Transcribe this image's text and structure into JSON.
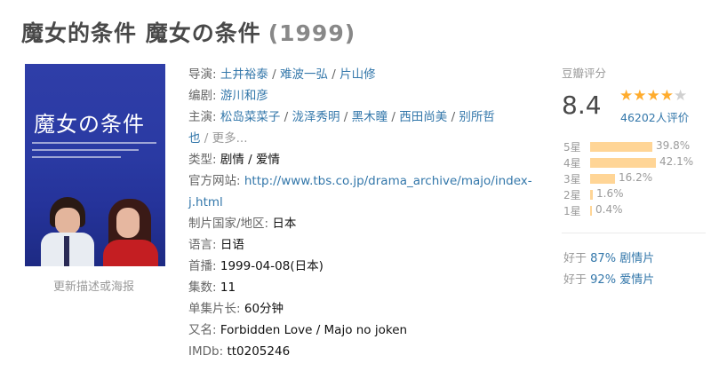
{
  "title": {
    "main": "魔女的条件 魔女の条件",
    "year": "(1999)"
  },
  "poster": {
    "title_text": "魔女の条件"
  },
  "update_link": "更新描述或海报",
  "info": {
    "director_label": "导演:",
    "directors": [
      "土井裕泰",
      "难波一弘",
      "片山修"
    ],
    "writer_label": "编剧:",
    "writers": [
      "游川和彦"
    ],
    "cast_label": "主演:",
    "cast_line1": [
      "松岛菜菜子",
      "泷泽秀明",
      "黑木瞳",
      "西田尚美",
      "别所哲"
    ],
    "cast_line2_start": "也",
    "cast_more": "/ 更多...",
    "genre_label": "类型:",
    "genres": "剧情 / 爱情",
    "site_label": "官方网站:",
    "site_line1": "http://www.tbs.co.jp/drama_archive/majo/index-",
    "site_line2": "j.html",
    "country_label": "制片国家/地区:",
    "country": "日本",
    "language_label": "语言:",
    "language": "日语",
    "premiere_label": "首播:",
    "premiere": "1999-04-08(日本)",
    "episodes_label": "集数:",
    "episodes": "11",
    "runtime_label": "单集片长:",
    "runtime": "60分钟",
    "aka_label": "又名:",
    "aka": "Forbidden Love / Majo no joken",
    "imdb_label": "IMDb:",
    "imdb": "tt0205246"
  },
  "rating": {
    "label": "豆瓣评分",
    "score": "8.4",
    "stars_value": 4.5,
    "votes": "46202人评价",
    "distribution": [
      {
        "label": "5星",
        "percent": "39.8%",
        "value": 39.8
      },
      {
        "label": "4星",
        "percent": "42.1%",
        "value": 42.1
      },
      {
        "label": "3星",
        "percent": "16.2%",
        "value": 16.2
      },
      {
        "label": "2星",
        "percent": "1.6%",
        "value": 1.6
      },
      {
        "label": "1星",
        "percent": "0.4%",
        "value": 0.4
      }
    ]
  },
  "better_than": [
    {
      "prefix": "好于",
      "percent": "87%",
      "genre": "剧情片"
    },
    {
      "prefix": "好于",
      "percent": "92%",
      "genre": "爱情片"
    }
  ],
  "colors": {
    "link": "#3377aa",
    "star": "#ffac2d",
    "bar": "#ffd596"
  }
}
